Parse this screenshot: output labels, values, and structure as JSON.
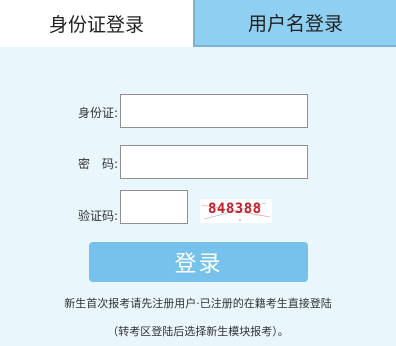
{
  "tabs": {
    "id_card": "身份证登录",
    "username": "用户名登录"
  },
  "form": {
    "id_label": "身份证:",
    "password_label": "密　码:",
    "captcha_label": "验证码:",
    "id_value": "",
    "password_value": "",
    "captcha_value": "",
    "captcha_image_text": "848388",
    "login_button": "登录"
  },
  "notes": {
    "line1": "新生首次报考请先注册用户·已注册的在籍考生直接登陆",
    "line2": "（转考区登陆后选择新生模块报考）。"
  },
  "colors": {
    "active_tab_bg": "#ffffff",
    "inactive_tab_bg": "#8fd0f2",
    "panel_bg": "#e9f6fc",
    "button_bg": "#76c2ec",
    "captcha_text": "#c0202a"
  }
}
